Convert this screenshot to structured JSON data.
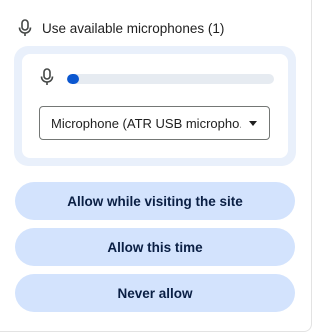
{
  "header": {
    "icon": "microphone-icon",
    "label": "Use available microphones (1)"
  },
  "mic_level": {
    "icon": "microphone-icon",
    "level_fraction": 0.06,
    "fill_color": "#0b57d0"
  },
  "device_select": {
    "selected_value": "Microphone (ATR USB micropho...",
    "icon": "chevron-down-icon"
  },
  "buttons": {
    "allow_while_visiting": "Allow while visiting the site",
    "allow_this_time": "Allow this time",
    "never_allow": "Never allow"
  },
  "colors": {
    "button_bg": "#d3e3fd",
    "card_bg": "#e9f0fb",
    "accent": "#0b57d0"
  }
}
